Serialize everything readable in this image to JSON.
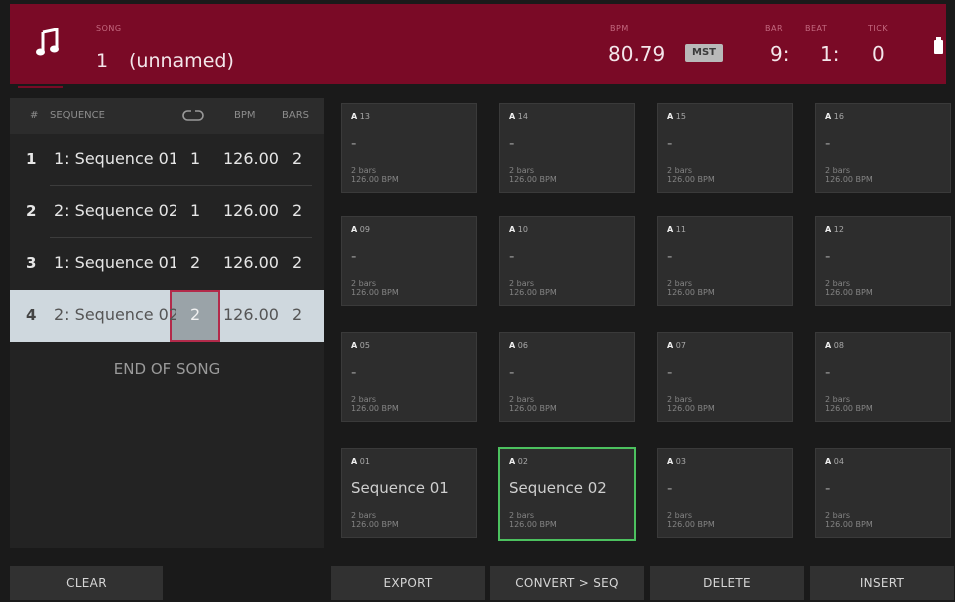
{
  "header": {
    "song_label": "SONG",
    "song_number": "1",
    "song_name": "(unnamed)",
    "tempo_label": "BPM",
    "tempo_value": "80.79",
    "tempo_source": "MST",
    "bar_label": "BAR",
    "bar_value": "9:",
    "beat_label": "BEAT",
    "beat_value": "1:",
    "tick_label": "TICK",
    "tick_value": "0"
  },
  "seq_list": {
    "columns": {
      "index": "#",
      "sequence": "SEQUENCE",
      "bpm": "BPM",
      "bars": "BARS"
    },
    "rows": [
      {
        "num": "1",
        "name": "1: Sequence 01",
        "loops": "1",
        "bpm": "126.00",
        "bars": "2"
      },
      {
        "num": "2",
        "name": "2: Sequence 02",
        "loops": "1",
        "bpm": "126.00",
        "bars": "2"
      },
      {
        "num": "3",
        "name": "1: Sequence 01",
        "loops": "2",
        "bpm": "126.00",
        "bars": "2"
      },
      {
        "num": "4",
        "name": "2: Sequence 02",
        "loops": "2",
        "bpm": "126.00",
        "bars": "2"
      }
    ],
    "end_label": "END OF SONG"
  },
  "pads": [
    {
      "bank": "A",
      "num": "13",
      "name": "-",
      "bars": "2 bars",
      "bpm": "126.00 BPM"
    },
    {
      "bank": "A",
      "num": "14",
      "name": "-",
      "bars": "2 bars",
      "bpm": "126.00 BPM"
    },
    {
      "bank": "A",
      "num": "15",
      "name": "-",
      "bars": "2 bars",
      "bpm": "126.00 BPM"
    },
    {
      "bank": "A",
      "num": "16",
      "name": "-",
      "bars": "2 bars",
      "bpm": "126.00 BPM"
    },
    {
      "bank": "A",
      "num": "09",
      "name": "-",
      "bars": "2 bars",
      "bpm": "126.00 BPM"
    },
    {
      "bank": "A",
      "num": "10",
      "name": "-",
      "bars": "2 bars",
      "bpm": "126.00 BPM"
    },
    {
      "bank": "A",
      "num": "11",
      "name": "-",
      "bars": "2 bars",
      "bpm": "126.00 BPM"
    },
    {
      "bank": "A",
      "num": "12",
      "name": "-",
      "bars": "2 bars",
      "bpm": "126.00 BPM"
    },
    {
      "bank": "A",
      "num": "05",
      "name": "-",
      "bars": "2 bars",
      "bpm": "126.00 BPM"
    },
    {
      "bank": "A",
      "num": "06",
      "name": "-",
      "bars": "2 bars",
      "bpm": "126.00 BPM"
    },
    {
      "bank": "A",
      "num": "07",
      "name": "-",
      "bars": "2 bars",
      "bpm": "126.00 BPM"
    },
    {
      "bank": "A",
      "num": "08",
      "name": "-",
      "bars": "2 bars",
      "bpm": "126.00 BPM"
    },
    {
      "bank": "A",
      "num": "01",
      "name": "Sequence 01",
      "bars": "2 bars",
      "bpm": "126.00 BPM"
    },
    {
      "bank": "A",
      "num": "02",
      "name": "Sequence 02",
      "bars": "2 bars",
      "bpm": "126.00 BPM"
    },
    {
      "bank": "A",
      "num": "03",
      "name": "-",
      "bars": "2 bars",
      "bpm": "126.00 BPM"
    },
    {
      "bank": "A",
      "num": "04",
      "name": "-",
      "bars": "2 bars",
      "bpm": "126.00 BPM"
    }
  ],
  "footer": {
    "clear": "CLEAR",
    "export": "EXPORT",
    "convert": "CONVERT > SEQ",
    "delete": "DELETE",
    "insert": "INSERT"
  },
  "colors": {
    "header_bg": "#7a0a26",
    "selected_pad_border": "#4cc15f",
    "selected_row_bg": "#cfd8de",
    "loop_highlight_border": "#b32a4a"
  },
  "icons": {
    "mode": "music-note-icon",
    "loop_column": "loop-icon",
    "battery": "battery-icon"
  }
}
